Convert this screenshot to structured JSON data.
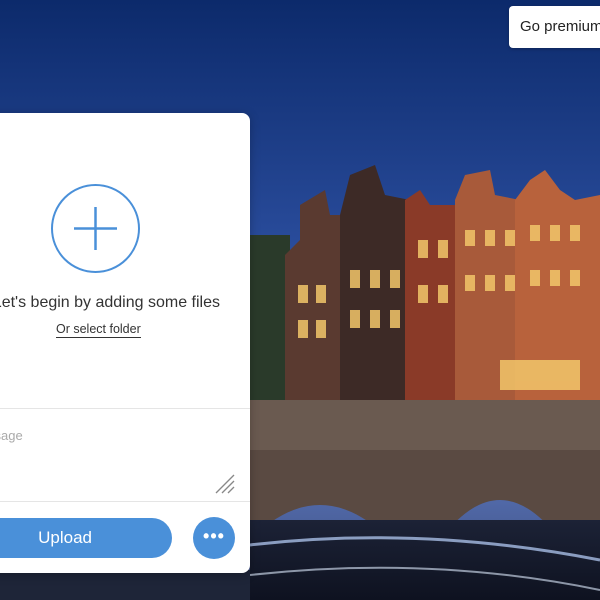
{
  "header": {
    "premium_label": "Go premium"
  },
  "uploader": {
    "add_files_label": "Let's begin by adding some files",
    "select_folder_label": "Or select folder",
    "message_placeholder": "Message",
    "upload_label": "Upload",
    "more_options_label": "•••"
  },
  "icons": {
    "add": "plus-circle-icon",
    "resize": "resize-grip-icon",
    "more": "more-dots-icon"
  },
  "colors": {
    "accent": "#4a90d9",
    "sky_top": "#0c2a6b",
    "sky_bottom": "#5a78c0"
  }
}
